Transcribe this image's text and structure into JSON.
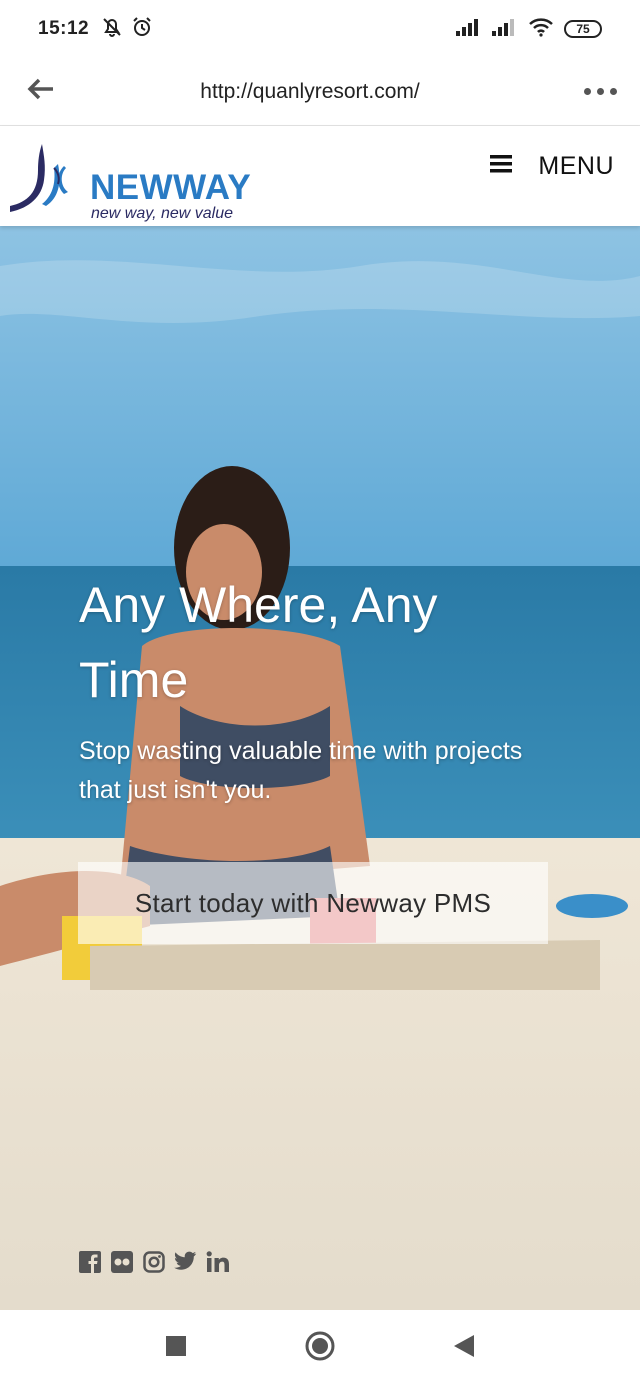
{
  "status_bar": {
    "time": "15:12",
    "battery": "75",
    "icons": [
      "mute-bell-icon",
      "alarm-icon",
      "signal-icon",
      "signal-icon",
      "wifi-icon",
      "battery-icon"
    ]
  },
  "browser": {
    "url": "http://quanlyresort.com/",
    "back_icon": "back-arrow-icon",
    "more_icon": "more-dots-icon"
  },
  "site_header": {
    "brand_name": "NEWWAY",
    "tagline": "new way, new value",
    "menu_label": "MENU",
    "menu_icon": "hamburger-icon"
  },
  "hero": {
    "title": "Any Where, Any Time",
    "subtitle": "Stop wasting valuable time with projects that just isn't you.",
    "cta_label": "Start today with Newway PMS",
    "social_icons": [
      "facebook-icon",
      "flickr-icon",
      "instagram-icon",
      "twitter-icon",
      "linkedin-icon"
    ]
  },
  "nav_bar": {
    "icons": [
      "recents-square-icon",
      "home-circle-icon",
      "back-triangle-icon"
    ]
  },
  "colors": {
    "brand_blue": "#2a7bc4",
    "brand_navy": "#2b2b63",
    "sky": "#6fb2d8",
    "sea": "#2f7ea8",
    "sand": "#e9e1d2"
  }
}
